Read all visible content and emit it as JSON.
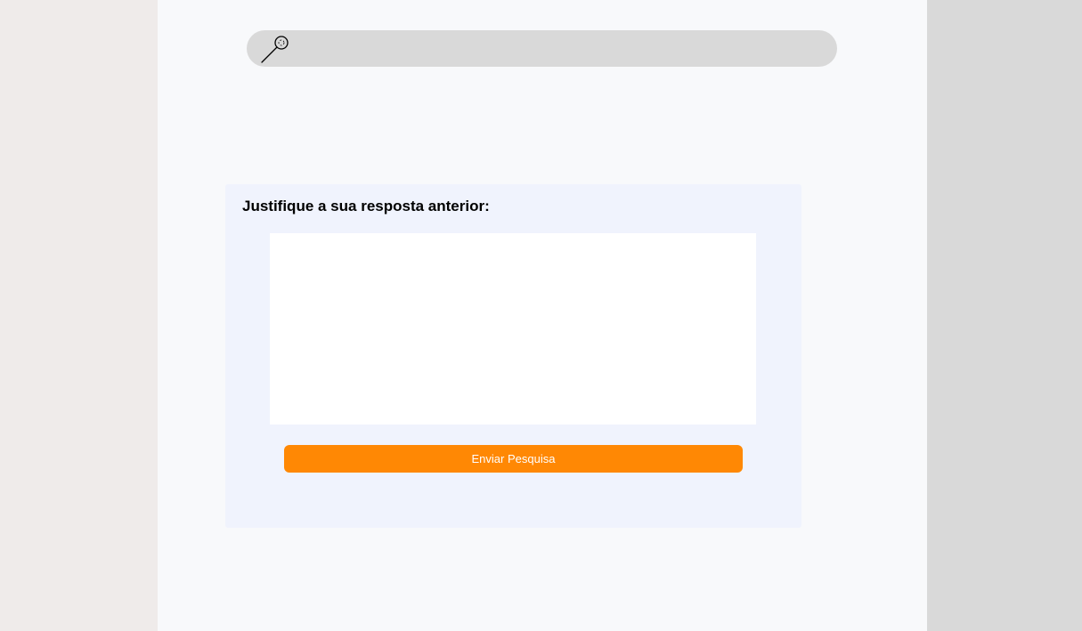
{
  "search": {
    "icon": "search-icon",
    "placeholder": ""
  },
  "survey": {
    "question": "Justifique a sua resposta anterior:",
    "answer_value": "",
    "submit_label": "Enviar Pesquisa"
  },
  "colors": {
    "accent": "#ff8804",
    "card_background": "#f0f3fd",
    "search_background": "#d9d9d9",
    "page_background": "#f8f9fb"
  }
}
